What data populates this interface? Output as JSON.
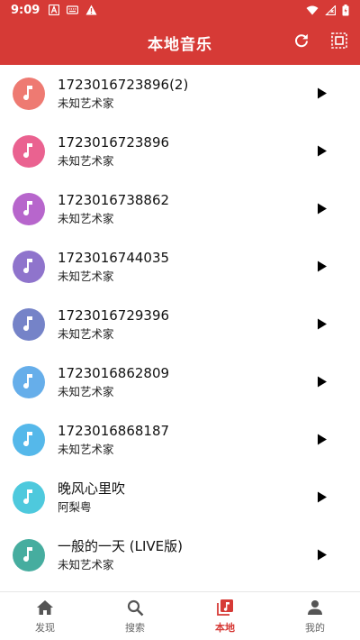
{
  "status_bar": {
    "time": "9:09",
    "left_icons": [
      "a-notification-icon",
      "keyboard-icon",
      "warning-icon"
    ],
    "right_icons": [
      "wifi-icon",
      "no-signal-icon",
      "battery-icon"
    ]
  },
  "header": {
    "title": "本地音乐",
    "actions": [
      "refresh-icon",
      "select-all-icon"
    ]
  },
  "songs": [
    {
      "title": "1723016723896(2)",
      "artist": "未知艺术家",
      "cover_color": "#ee7a72"
    },
    {
      "title": "1723016723896",
      "artist": "未知艺术家",
      "cover_color": "#ea6290"
    },
    {
      "title": "1723016738862",
      "artist": "未知艺术家",
      "cover_color": "#b766cc"
    },
    {
      "title": "1723016744035",
      "artist": "未知艺术家",
      "cover_color": "#8f74cc"
    },
    {
      "title": "1723016729396",
      "artist": "未知艺术家",
      "cover_color": "#7583c8"
    },
    {
      "title": "1723016862809",
      "artist": "未知艺术家",
      "cover_color": "#66aeea"
    },
    {
      "title": "1723016868187",
      "artist": "未知艺术家",
      "cover_color": "#55b8ea"
    },
    {
      "title": "晚风心里吹",
      "artist": "阿梨粤",
      "cover_color": "#4ec9dd"
    },
    {
      "title": "一般的一天 (LIVE版)",
      "artist": "未知艺术家",
      "cover_color": "#46ad9f"
    }
  ],
  "bottom_nav": [
    {
      "label": "发现",
      "icon": "home-icon",
      "active": false
    },
    {
      "label": "搜索",
      "icon": "search-icon",
      "active": false
    },
    {
      "label": "本地",
      "icon": "local-music-icon",
      "active": true
    },
    {
      "label": "我的",
      "icon": "person-icon",
      "active": false
    }
  ],
  "colors": {
    "accent": "#d63a36",
    "inactive_nav": "#666666",
    "background": "#ffffff"
  }
}
